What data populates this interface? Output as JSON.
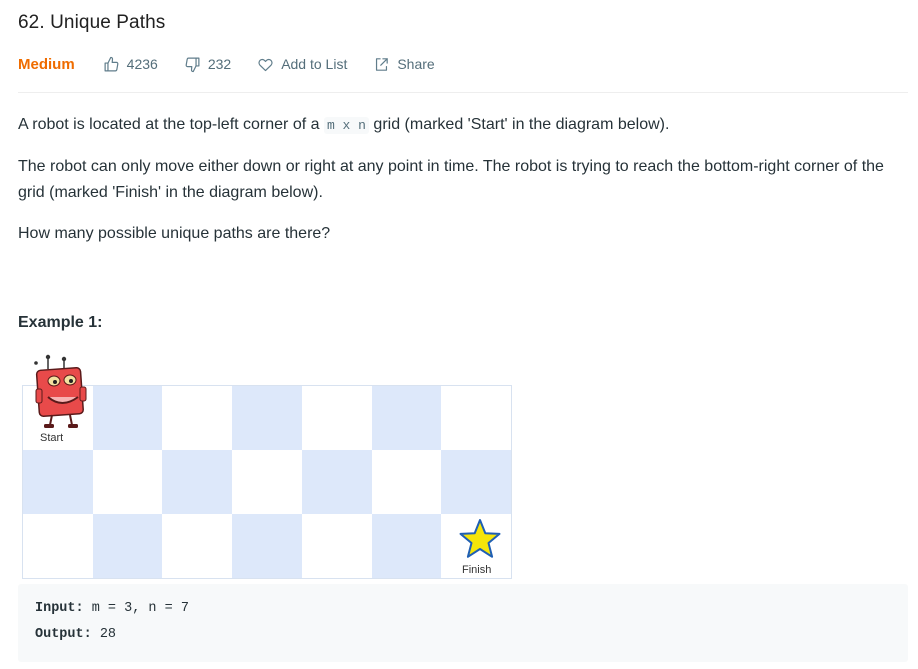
{
  "problem": {
    "title": "62. Unique Paths",
    "difficulty": "Medium",
    "likes": "4236",
    "dislikes": "232",
    "add_to_list": "Add to List",
    "share": "Share"
  },
  "description": {
    "p1_before": "A robot is located at the top-left corner of a ",
    "p1_code": "m x n",
    "p1_after": " grid (marked 'Start' in the diagram below).",
    "p2": "The robot can only move either down or right at any point in time. The robot is trying to reach the bottom-right corner of the grid (marked 'Finish' in the diagram below).",
    "p3": "How many possible unique paths are there?"
  },
  "example": {
    "heading": "Example 1:",
    "grid": {
      "rows": 3,
      "cols": 7
    },
    "start_label": "Start",
    "finish_label": "Finish",
    "input_label": "Input:",
    "input_value": " m = 3, n = 7",
    "output_label": "Output:",
    "output_value": " 28"
  },
  "colors": {
    "difficulty": "#ef6c00",
    "grid_blue": "#dde8fa",
    "star_fill": "#f5e50a",
    "robot_red": "#e84a4a"
  }
}
